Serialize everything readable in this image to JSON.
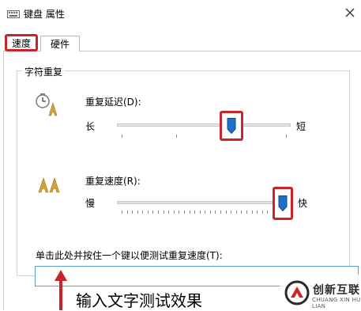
{
  "window": {
    "title": "键盘 属性"
  },
  "tabs": [
    {
      "label": "速度",
      "selected": true
    },
    {
      "label": "硬件",
      "selected": false
    }
  ],
  "group": {
    "title": "字符重复",
    "repeat_delay": {
      "label": "重复延迟(D):",
      "min_label": "长",
      "max_label": "短",
      "value_fraction": 0.67,
      "ticks": 4
    },
    "repeat_rate": {
      "label": "重复速度(R):",
      "min_label": "慢",
      "max_label": "快",
      "value_fraction": 1.0,
      "ticks": 32
    },
    "test_prompt": "单击此处并按住一个键以便测试重复速度(T):",
    "test_input_value": ""
  },
  "annotation": "输入文字测试效果",
  "colors": {
    "highlight": "#c9242a",
    "thumb": "#1e6fc8",
    "input_border": "#5a9bd6"
  },
  "watermark": {
    "text": "创新互联",
    "subtitle": "CHUANG XIN HU LIAN"
  }
}
